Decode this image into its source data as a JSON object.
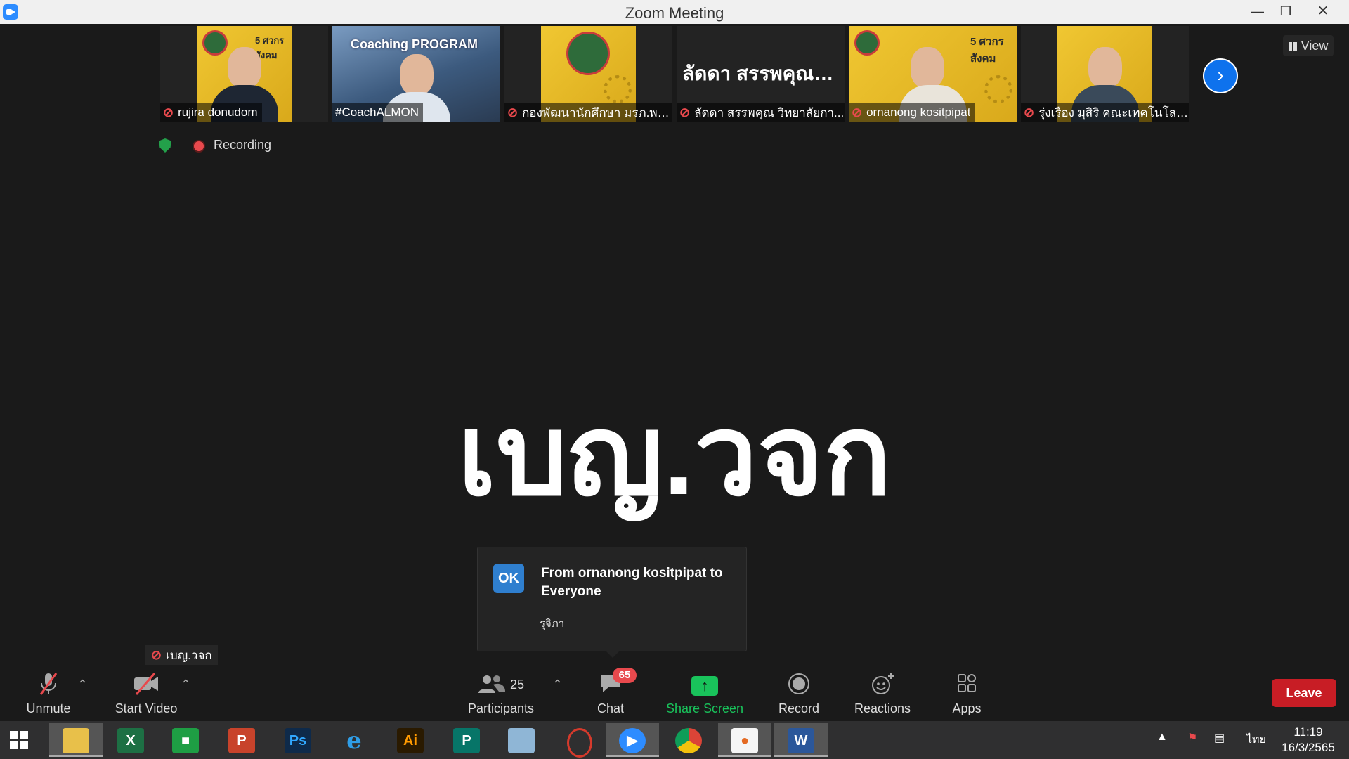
{
  "window": {
    "title": "Zoom Meeting"
  },
  "participants_strip": [
    {
      "name": "rujira donudom",
      "muted": true,
      "kind": "photo"
    },
    {
      "name": "#CoachALMON",
      "muted": false,
      "kind": "video",
      "banner": "Coaching PROGRAM"
    },
    {
      "name": "กองพัฒนานักศึกษา มรภ.พร...",
      "muted": true,
      "kind": "logo"
    },
    {
      "name": "ลัดดา สรรพคุณ วิทยาลัยกา...",
      "muted": true,
      "kind": "name",
      "display": "ลัดดา สรรพคุณ วิ..."
    },
    {
      "name": "ornanong kositpipat",
      "muted": true,
      "kind": "photo"
    },
    {
      "name": "รุ่งเรือง มุสิริ คณะเทคโนโลยีอุ...",
      "muted": true,
      "kind": "photo"
    }
  ],
  "strip_thumb_text": "5 ศวกร สังคม",
  "view_button": "View",
  "recording_label": "Recording",
  "active_speaker_name": "เบญ.วจก",
  "self_tile": {
    "name": "เบญ.วจก",
    "muted": true
  },
  "chat_toast": {
    "avatar_initials": "OK",
    "heading": "From ornanong kositpipat to Everyone",
    "message": "รุจิภา"
  },
  "toolbar": {
    "unmute": "Unmute",
    "start_video": "Start Video",
    "participants": "Participants",
    "participants_count": "25",
    "chat": "Chat",
    "chat_badge": "65",
    "share_screen": "Share Screen",
    "record": "Record",
    "reactions": "Reactions",
    "apps": "Apps",
    "leave": "Leave"
  },
  "taskbar": {
    "apps": [
      "file-explorer",
      "excel",
      "store",
      "powerpoint",
      "photoshop",
      "internet-explorer",
      "illustrator",
      "publisher",
      "notepad",
      "photoscape",
      "zoom",
      "chrome",
      "paint",
      "word"
    ],
    "language": "ไทย",
    "time": "11:19",
    "date": "16/3/2565"
  },
  "colors": {
    "accent": "#0e72ed",
    "leave": "#c81d25",
    "share": "#19c35b",
    "muted": "#e8494d"
  }
}
